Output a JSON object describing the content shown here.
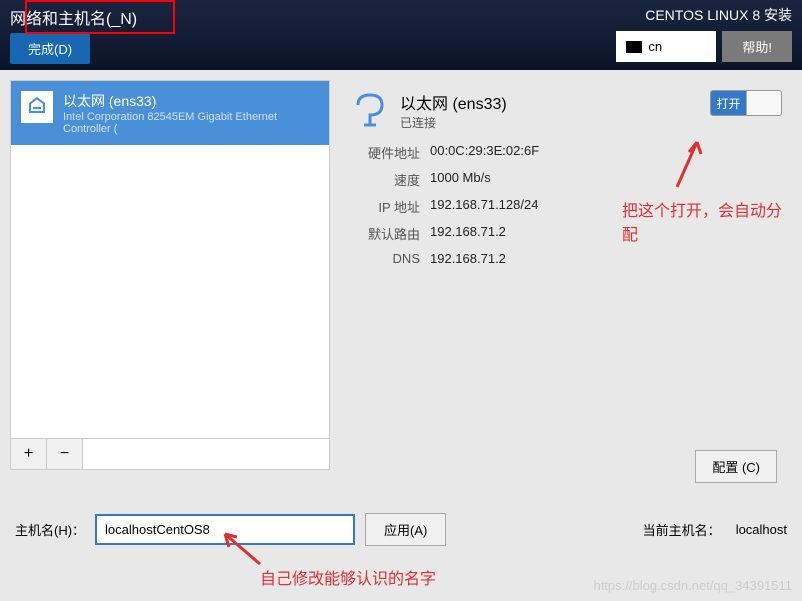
{
  "header": {
    "title": "网络和主机名(_N)",
    "done_button": "完成(D)",
    "installer_title": "CENTOS LINUX 8 安装",
    "keyboard": "cn",
    "help_button": "帮助!"
  },
  "network_list": {
    "item": {
      "name": "以太网 (ens33)",
      "description": "Intel Corporation 82545EM Gigabit Ethernet Controller ("
    },
    "add_btn": "+",
    "remove_btn": "−"
  },
  "device": {
    "title": "以太网 (ens33)",
    "status": "已连接",
    "toggle_label": "打开",
    "details": [
      {
        "label": "硬件地址",
        "value": "00:0C:29:3E:02:6F"
      },
      {
        "label": "速度",
        "value": "1000 Mb/s"
      },
      {
        "label": "IP 地址",
        "value": "192.168.71.128/24"
      },
      {
        "label": "默认路由",
        "value": "192.168.71.2"
      },
      {
        "label": "DNS",
        "value": "192.168.71.2"
      }
    ]
  },
  "configure_button": "配置 (C)",
  "hostname": {
    "label": "主机名(H)：",
    "value": "localhostCentOS8",
    "apply_button": "应用(A)",
    "current_label": "当前主机名：",
    "current_value": "localhost"
  },
  "annotations": {
    "toggle_hint": "把这个打开，会自动分配",
    "hostname_hint": "自己修改能够认识的名字"
  },
  "watermark": "https://blog.csdn.net/qq_34391511"
}
